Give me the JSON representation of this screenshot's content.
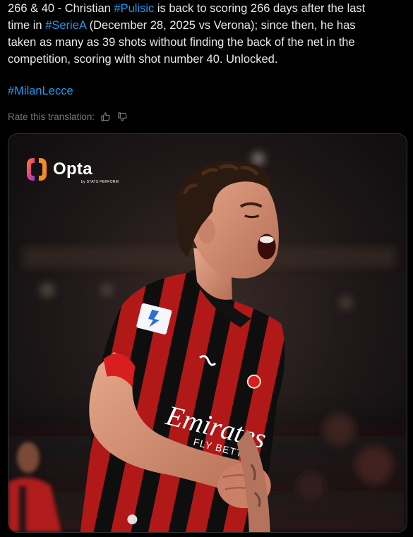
{
  "tweet": {
    "line1_prefix": "266 & 40 - Christian ",
    "hashtag_pulisic": "#Pulisic",
    "line1_suffix": " is back to scoring 266 days after the last",
    "line2_prefix": "time in ",
    "hashtag_seriea": "#SerieA",
    "line2_suffix": " (December 28, 2025 vs Verona); since then, he has",
    "line3": "taken as many as 39 shots without finding the back of the net in the",
    "line4": "competition, scoring with shot number 40. Unlocked.",
    "hashtag_milanlecce": "#MilanLecce"
  },
  "translation": {
    "rate_label": "Rate this translation:",
    "thumbs_up_icon": "thumbs-up-icon",
    "thumbs_down_icon": "thumbs-down-icon"
  },
  "media": {
    "logo_text": "Opta",
    "logo_subtext": "by STATS PERFORM",
    "shirt_sponsor": "Emirates",
    "shirt_sponsor_sub": "FLY BETTER"
  },
  "colors": {
    "hashtag": "#1d9bf0",
    "text": "#e7e9ea",
    "muted": "#71767b",
    "milan_red": "#d81e1e",
    "milan_black": "#121212"
  }
}
